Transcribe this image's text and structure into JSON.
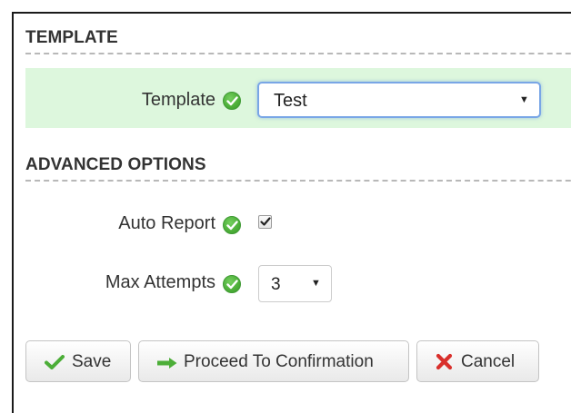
{
  "sections": {
    "template_heading": "TEMPLATE",
    "advanced_heading": "ADVANCED OPTIONS"
  },
  "template_field": {
    "label": "Template",
    "selected_value": "Test"
  },
  "auto_report": {
    "label": "Auto Report",
    "checked": true
  },
  "max_attempts": {
    "label": "Max Attempts",
    "selected_value": "3"
  },
  "buttons": {
    "save": "Save",
    "proceed": "Proceed To Confirmation",
    "cancel": "Cancel"
  },
  "icons": {
    "ok": "check-circle-icon",
    "save": "checkmark-icon",
    "proceed": "arrow-right-icon",
    "cancel": "x-icon"
  },
  "colors": {
    "row_highlight": "#ddf7dd",
    "ok_green": "#4cae38",
    "cancel_red": "#d9302c",
    "focus_blue": "#79a6e6"
  }
}
